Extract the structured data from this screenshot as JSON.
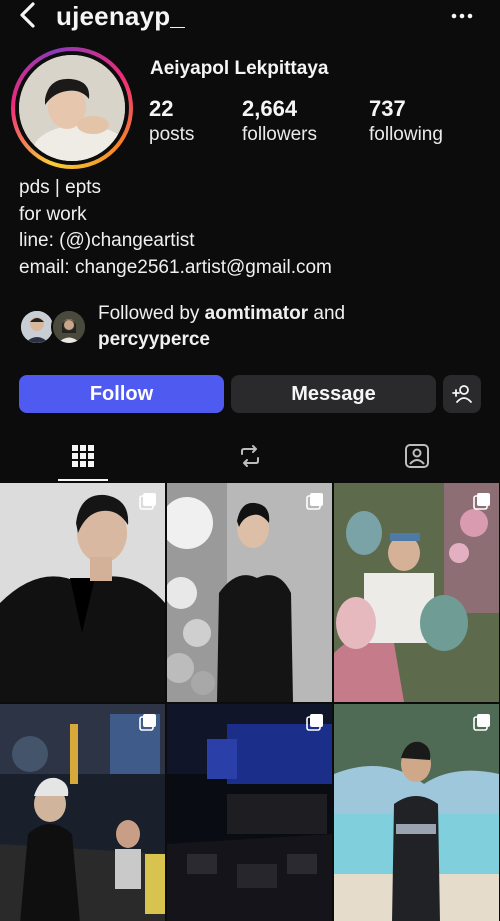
{
  "header": {
    "username": "ujeenayp_",
    "back_icon": "chevron-left-icon",
    "more_icon": "more-horizontal-icon"
  },
  "profile": {
    "full_name": "Aeiyapol Lekpittaya",
    "stats": [
      {
        "value": "22",
        "label": "posts"
      },
      {
        "value": "2,664",
        "label": "followers"
      },
      {
        "value": "737",
        "label": "following"
      }
    ],
    "bio_lines": [
      "pds | epts",
      "for work",
      "line: (@)changeartist",
      "email: change2561.artist@gmail.com"
    ],
    "followed_by": {
      "prefix": "Followed by ",
      "user1": "aomtimator",
      "connector": " and",
      "user2": "percyyperce"
    }
  },
  "actions": {
    "follow_label": "Follow",
    "message_label": "Message",
    "add_user_icon": "add-user-icon"
  },
  "tabs": [
    {
      "name": "posts",
      "icon": "grid-icon"
    },
    {
      "name": "reels",
      "icon": "reels-icon"
    },
    {
      "name": "tagged",
      "icon": "tagged-person-icon"
    }
  ],
  "colors": {
    "background": "#0c0c0d",
    "follow_button": "#4f5bf0",
    "secondary_button": "#2a2a2c"
  }
}
